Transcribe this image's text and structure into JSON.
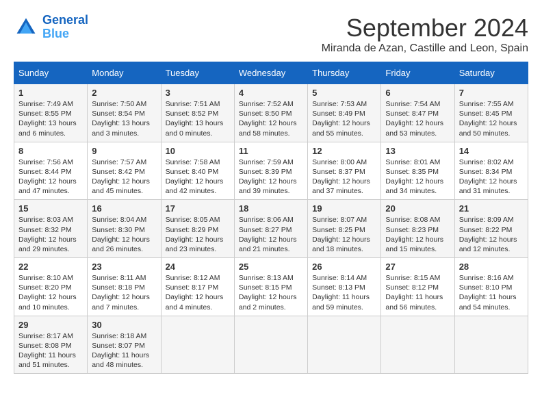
{
  "logo": {
    "line1": "General",
    "line2": "Blue"
  },
  "title": "September 2024",
  "subtitle": "Miranda de Azan, Castille and Leon, Spain",
  "days_of_week": [
    "Sunday",
    "Monday",
    "Tuesday",
    "Wednesday",
    "Thursday",
    "Friday",
    "Saturday"
  ],
  "weeks": [
    [
      {
        "day": "1",
        "sunrise": "7:49 AM",
        "sunset": "8:55 PM",
        "daylight": "13 hours and 6 minutes."
      },
      {
        "day": "2",
        "sunrise": "7:50 AM",
        "sunset": "8:54 PM",
        "daylight": "13 hours and 3 minutes."
      },
      {
        "day": "3",
        "sunrise": "7:51 AM",
        "sunset": "8:52 PM",
        "daylight": "13 hours and 0 minutes."
      },
      {
        "day": "4",
        "sunrise": "7:52 AM",
        "sunset": "8:50 PM",
        "daylight": "12 hours and 58 minutes."
      },
      {
        "day": "5",
        "sunrise": "7:53 AM",
        "sunset": "8:49 PM",
        "daylight": "12 hours and 55 minutes."
      },
      {
        "day": "6",
        "sunrise": "7:54 AM",
        "sunset": "8:47 PM",
        "daylight": "12 hours and 53 minutes."
      },
      {
        "day": "7",
        "sunrise": "7:55 AM",
        "sunset": "8:45 PM",
        "daylight": "12 hours and 50 minutes."
      }
    ],
    [
      {
        "day": "8",
        "sunrise": "7:56 AM",
        "sunset": "8:44 PM",
        "daylight": "12 hours and 47 minutes."
      },
      {
        "day": "9",
        "sunrise": "7:57 AM",
        "sunset": "8:42 PM",
        "daylight": "12 hours and 45 minutes."
      },
      {
        "day": "10",
        "sunrise": "7:58 AM",
        "sunset": "8:40 PM",
        "daylight": "12 hours and 42 minutes."
      },
      {
        "day": "11",
        "sunrise": "7:59 AM",
        "sunset": "8:39 PM",
        "daylight": "12 hours and 39 minutes."
      },
      {
        "day": "12",
        "sunrise": "8:00 AM",
        "sunset": "8:37 PM",
        "daylight": "12 hours and 37 minutes."
      },
      {
        "day": "13",
        "sunrise": "8:01 AM",
        "sunset": "8:35 PM",
        "daylight": "12 hours and 34 minutes."
      },
      {
        "day": "14",
        "sunrise": "8:02 AM",
        "sunset": "8:34 PM",
        "daylight": "12 hours and 31 minutes."
      }
    ],
    [
      {
        "day": "15",
        "sunrise": "8:03 AM",
        "sunset": "8:32 PM",
        "daylight": "12 hours and 29 minutes."
      },
      {
        "day": "16",
        "sunrise": "8:04 AM",
        "sunset": "8:30 PM",
        "daylight": "12 hours and 26 minutes."
      },
      {
        "day": "17",
        "sunrise": "8:05 AM",
        "sunset": "8:29 PM",
        "daylight": "12 hours and 23 minutes."
      },
      {
        "day": "18",
        "sunrise": "8:06 AM",
        "sunset": "8:27 PM",
        "daylight": "12 hours and 21 minutes."
      },
      {
        "day": "19",
        "sunrise": "8:07 AM",
        "sunset": "8:25 PM",
        "daylight": "12 hours and 18 minutes."
      },
      {
        "day": "20",
        "sunrise": "8:08 AM",
        "sunset": "8:23 PM",
        "daylight": "12 hours and 15 minutes."
      },
      {
        "day": "21",
        "sunrise": "8:09 AM",
        "sunset": "8:22 PM",
        "daylight": "12 hours and 12 minutes."
      }
    ],
    [
      {
        "day": "22",
        "sunrise": "8:10 AM",
        "sunset": "8:20 PM",
        "daylight": "12 hours and 10 minutes."
      },
      {
        "day": "23",
        "sunrise": "8:11 AM",
        "sunset": "8:18 PM",
        "daylight": "12 hours and 7 minutes."
      },
      {
        "day": "24",
        "sunrise": "8:12 AM",
        "sunset": "8:17 PM",
        "daylight": "12 hours and 4 minutes."
      },
      {
        "day": "25",
        "sunrise": "8:13 AM",
        "sunset": "8:15 PM",
        "daylight": "12 hours and 2 minutes."
      },
      {
        "day": "26",
        "sunrise": "8:14 AM",
        "sunset": "8:13 PM",
        "daylight": "11 hours and 59 minutes."
      },
      {
        "day": "27",
        "sunrise": "8:15 AM",
        "sunset": "8:12 PM",
        "daylight": "11 hours and 56 minutes."
      },
      {
        "day": "28",
        "sunrise": "8:16 AM",
        "sunset": "8:10 PM",
        "daylight": "11 hours and 54 minutes."
      }
    ],
    [
      {
        "day": "29",
        "sunrise": "8:17 AM",
        "sunset": "8:08 PM",
        "daylight": "11 hours and 51 minutes."
      },
      {
        "day": "30",
        "sunrise": "8:18 AM",
        "sunset": "8:07 PM",
        "daylight": "11 hours and 48 minutes."
      },
      null,
      null,
      null,
      null,
      null
    ]
  ]
}
